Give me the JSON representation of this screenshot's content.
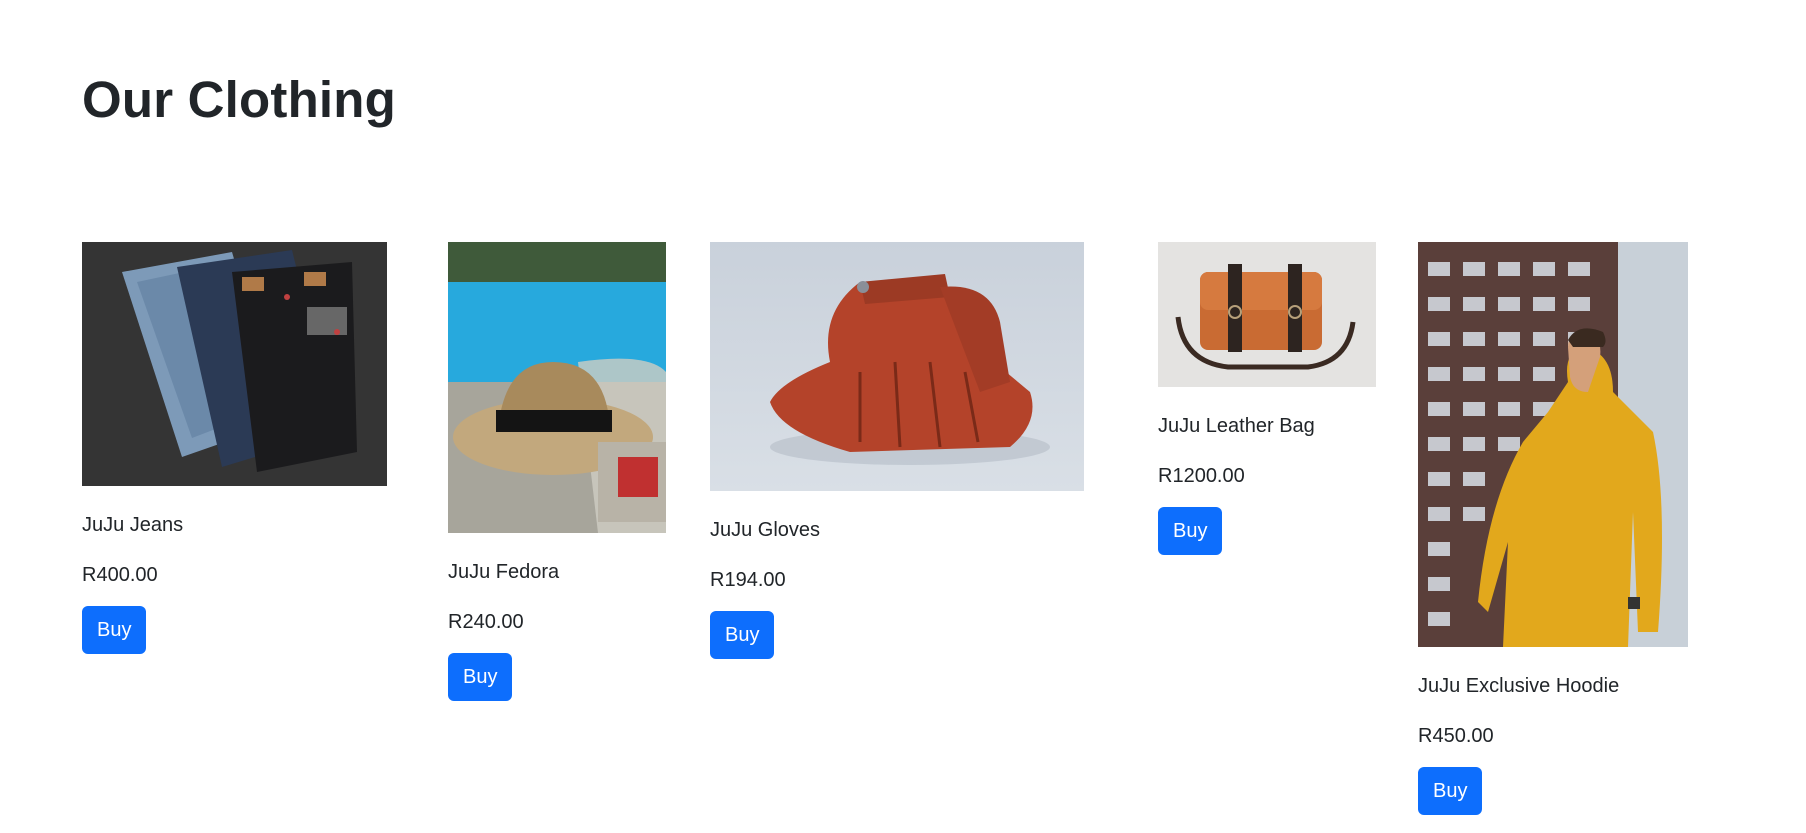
{
  "page": {
    "title": "Our Clothing"
  },
  "products": [
    {
      "name": "JuJu Jeans",
      "price": "R400.00",
      "button_label": "Buy",
      "image": "jeans-photo"
    },
    {
      "name": "JuJu Fedora",
      "price": "R240.00",
      "button_label": "Buy",
      "image": "fedora-photo"
    },
    {
      "name": "JuJu Gloves",
      "price": "R194.00",
      "button_label": "Buy",
      "image": "gloves-photo"
    },
    {
      "name": "JuJu Leather Bag",
      "price": "R1200.00",
      "button_label": "Buy",
      "image": "leather-bag-photo"
    },
    {
      "name": "JuJu Exclusive Hoodie",
      "price": "R450.00",
      "button_label": "Buy",
      "image": "hoodie-photo"
    }
  ],
  "colors": {
    "accent": "#0d6efd",
    "text": "#212529",
    "background": "#ffffff"
  }
}
